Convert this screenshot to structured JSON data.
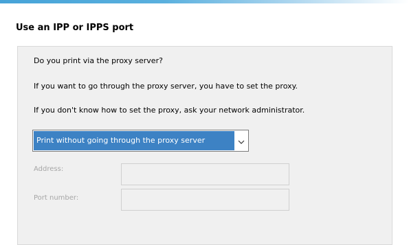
{
  "dialog": {
    "title": "Use an IPP or IPPS port"
  },
  "panel": {
    "question": "Do you print via the proxy server?",
    "info_proxy": "If you want to go through the proxy server, you have to set the proxy.",
    "info_admin": "If you don't know how to set the proxy, ask your network administrator."
  },
  "proxy_select": {
    "selected": "Print without going through the proxy server",
    "icon": "chevron-down-icon"
  },
  "fields": {
    "address_label": "Address:",
    "address_value": "",
    "port_label": "Port number:",
    "port_value": ""
  },
  "colors": {
    "accent": "#3d82c4",
    "top_strip": "#46a3d8",
    "disabled_text": "#a6a6a6",
    "panel_bg": "#f0f0f0"
  }
}
